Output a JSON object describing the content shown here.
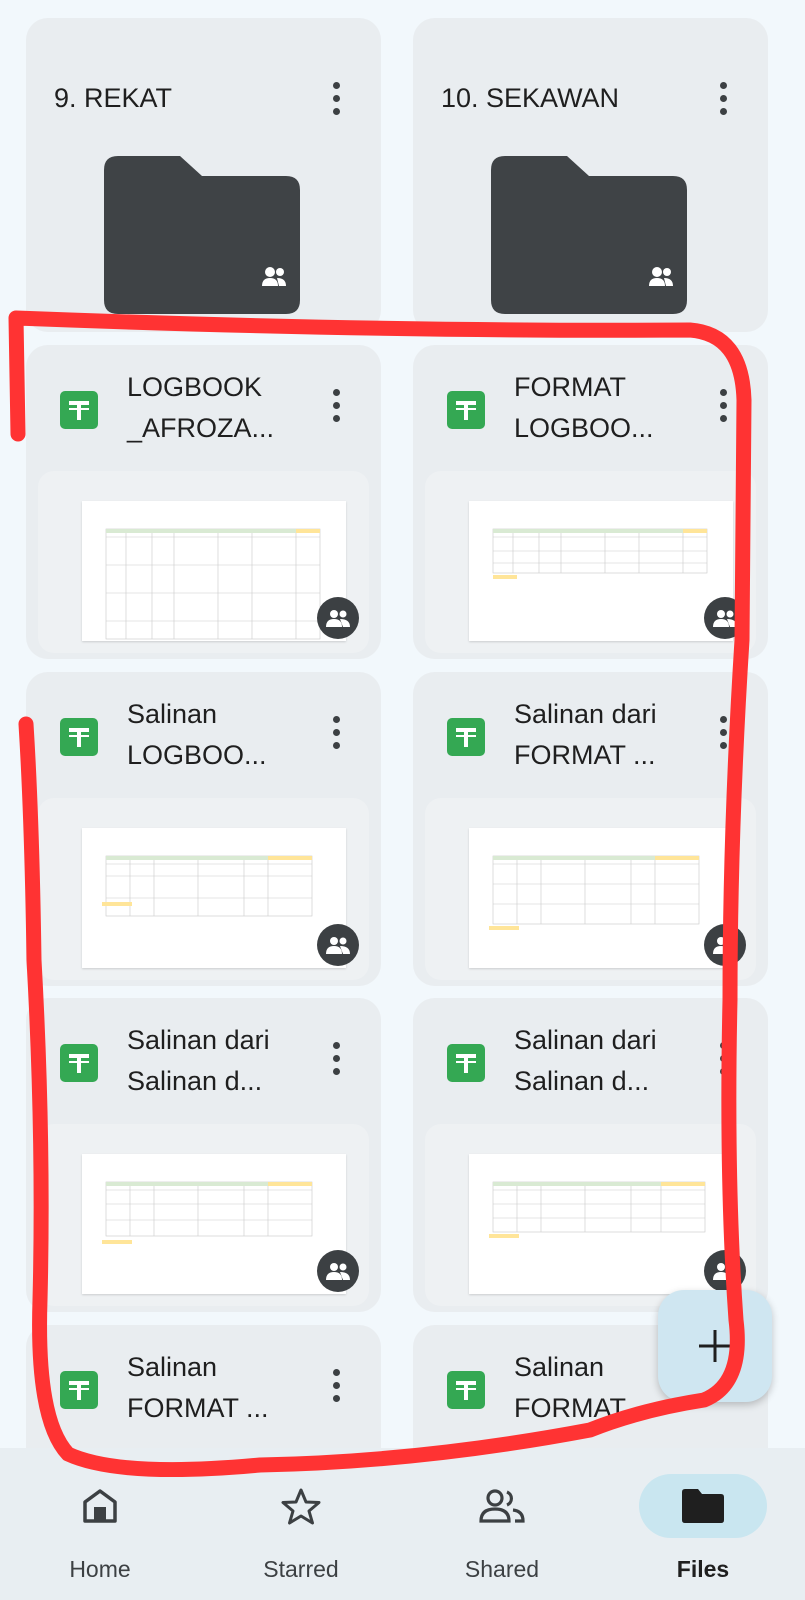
{
  "folders": [
    {
      "title": "9. REKAT"
    },
    {
      "title": "10. SEKAWAN"
    }
  ],
  "files": [
    {
      "title": "LOGBOOK\n_AFROZA..."
    },
    {
      "title": "FORMAT\nLOGBOO..."
    },
    {
      "title": "Salinan\nLOGBOO..."
    },
    {
      "title": "Salinan dari\nFORMAT ..."
    },
    {
      "title": "Salinan dari\nSalinan d..."
    },
    {
      "title": "Salinan dari\nSalinan d..."
    },
    {
      "title": "Salinan\nFORMAT ..."
    },
    {
      "title": "Salinan\nFORMAT ..."
    }
  ],
  "nav": [
    {
      "label": "Home",
      "icon": "home-icon"
    },
    {
      "label": "Starred",
      "icon": "star-icon"
    },
    {
      "label": "Shared",
      "icon": "shared-icon"
    },
    {
      "label": "Files",
      "icon": "folder-icon"
    }
  ],
  "fab": {
    "icon": "plus-icon"
  },
  "colors": {
    "background": "#f2f8fc",
    "card": "#e9edf0",
    "sheets_green": "#34a853",
    "folder_dark": "#3f4346",
    "nav_active": "#c9e6f0",
    "annotation_red": "#ff3333"
  }
}
